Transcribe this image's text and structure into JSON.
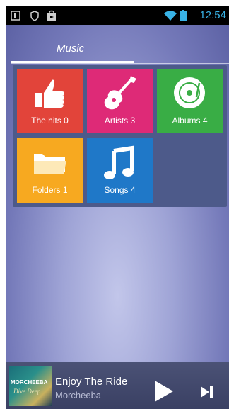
{
  "status_bar": {
    "time": "12:54",
    "icons": [
      "notification-1-icon",
      "shield-icon",
      "store-bag-icon",
      "wifi-icon",
      "battery-icon"
    ],
    "accent_color": "#39b3e6"
  },
  "tabs": [
    {
      "label": "Music",
      "selected": true
    }
  ],
  "tiles": [
    {
      "label": "The hits 0",
      "icon": "thumbs-up-icon",
      "color": "#e2443a"
    },
    {
      "label": "Artists 3",
      "icon": "guitar-icon",
      "color": "#de2a77"
    },
    {
      "label": "Albums 4",
      "icon": "vinyl-disc-icon",
      "color": "#39ad45"
    },
    {
      "label": "Folders 1",
      "icon": "folder-icon",
      "color": "#f7a920"
    },
    {
      "label": "Songs 4",
      "icon": "music-note-icon",
      "color": "#1f78c8"
    }
  ],
  "player": {
    "title": "Enjoy The Ride",
    "artist": "Morcheeba",
    "cover_text": "MORCHEEBA",
    "cover_subtext": "Dive Deep",
    "play_icon": "play-icon",
    "next_icon": "skip-next-icon"
  }
}
